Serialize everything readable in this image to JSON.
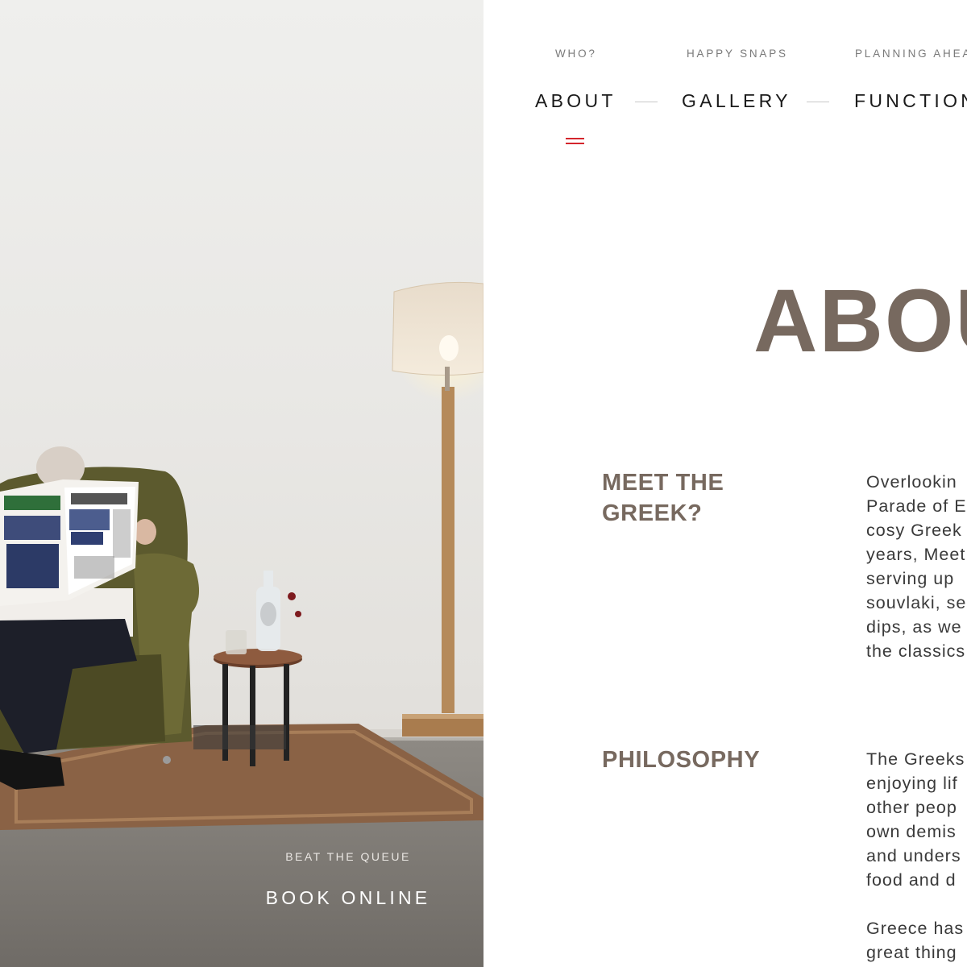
{
  "hero": {
    "image_alt": "Man reading a Greek newspaper in an armchair beside a lamp",
    "cta_caption": "BEAT THE QUEUE",
    "cta_button": "BOOK ONLINE"
  },
  "nav": {
    "items": [
      {
        "sub": "WHO?",
        "label": "ABOUT"
      },
      {
        "sub": "HAPPY SNAPS",
        "label": "GALLERY"
      },
      {
        "sub": "PLANNING AHEA",
        "label": "FUNCTION"
      }
    ],
    "active_index": 0
  },
  "page_title": "ABOU",
  "sections": [
    {
      "heading": "MEET THE\nGREEK?",
      "lines": [
        "Overlookin",
        "Parade of E",
        "cosy Greek",
        "years, Meet",
        "serving up",
        "souvlaki, se",
        "dips, as we",
        "the classics"
      ]
    },
    {
      "heading": "PHILOSOPHY",
      "lines": [
        "The Greeks",
        "enjoying lif",
        "other peop",
        "own demis",
        "and unders",
        "food and d",
        "",
        "Greece has",
        "great thing"
      ]
    }
  ],
  "colors": {
    "accent": "#d4252d",
    "heading": "#77695f",
    "body_text": "#3a3a3a",
    "nav_sub": "#7a7a7a"
  }
}
